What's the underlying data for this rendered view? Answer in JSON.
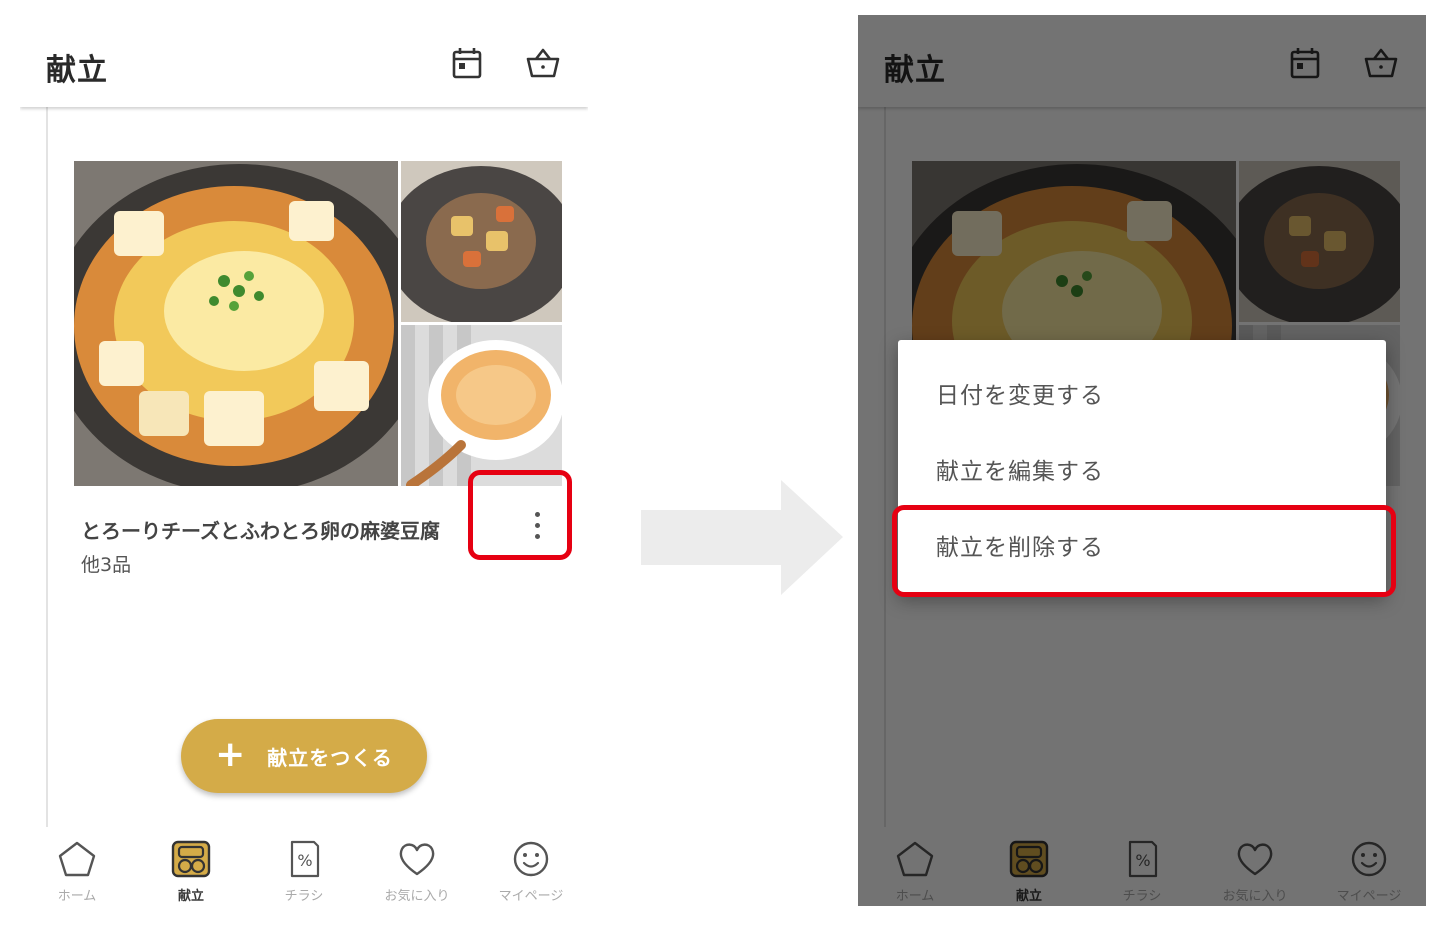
{
  "app": {
    "title": "献立",
    "header_icons": [
      "calendar-icon",
      "basket-icon"
    ]
  },
  "menu_card": {
    "dish_title": "とろーりチーズとふわとろ卵の麻婆豆腐",
    "dish_sub": "他3品",
    "more_icon": "more-vert-icon"
  },
  "fab": {
    "icon": "plus-icon",
    "label": "献立をつくる"
  },
  "bottom_nav": {
    "items": [
      {
        "label": "ホーム",
        "icon": "home-icon",
        "active": false
      },
      {
        "label": "献立",
        "icon": "menu-icon",
        "active": true
      },
      {
        "label": "チラシ",
        "icon": "flyer-icon",
        "active": false
      },
      {
        "label": "お気に入り",
        "icon": "heart-icon",
        "active": false
      },
      {
        "label": "マイページ",
        "icon": "smiley-icon",
        "active": false
      }
    ]
  },
  "context_menu": {
    "items": [
      "日付を変更する",
      "献立を編集する",
      "献立を削除する"
    ]
  },
  "colors": {
    "accent": "#d4ab48",
    "highlight": "#e60012",
    "scrim": "#000000"
  }
}
